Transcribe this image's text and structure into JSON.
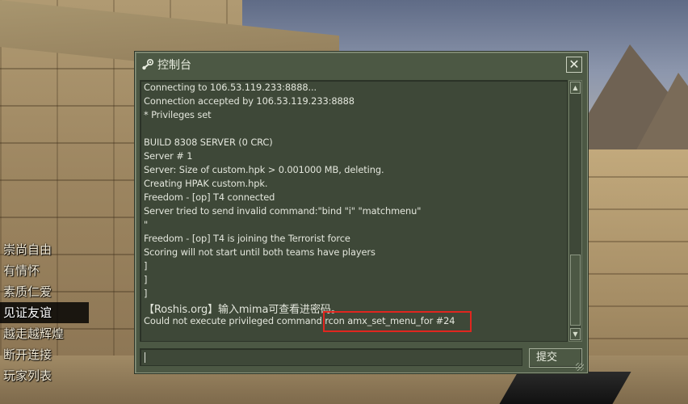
{
  "window": {
    "title": "控制台",
    "close_symbol": "✕",
    "submit_label": "提交",
    "input_value": ""
  },
  "console_lines": [
    "Connecting to 106.53.119.233:8888...",
    "Connection accepted by 106.53.119.233:8888",
    "* Privileges set",
    "",
    "BUILD 8308 SERVER (0 CRC)",
    "Server # 1",
    "Server: Size of custom.hpk > 0.001000 MB, deleting.",
    "Creating HPAK custom.hpk.",
    "Freedom - [op] T4 connected",
    "Server tried to send invalid command:\"bind \"i\" \"matchmenu\"",
    "\"",
    "Freedom - [op] T4 is joining the Terrorist force",
    "Scoring will not start until both teams have players",
    "]",
    "]",
    "]",
    "【Roshis.org】输入mima可查看进密码。",
    "Could not execute privileged command rcon amx_set_menu_for #24"
  ],
  "side_menu": [
    {
      "label": "崇尚自由",
      "active": false
    },
    {
      "label": "有情怀",
      "active": false
    },
    {
      "label": "素质仁爱",
      "active": false
    },
    {
      "label": "见证友谊",
      "active": true
    },
    {
      "label": "越走越辉煌",
      "active": false
    },
    {
      "label": "断开连接",
      "active": false
    },
    {
      "label": "玩家列表",
      "active": false
    }
  ],
  "icons": {
    "title": "steam-icon",
    "scroll_up": "arrow-up-icon",
    "scroll_down": "arrow-down-icon"
  },
  "colors": {
    "window_bg": "#4c5844",
    "output_bg": "#3e4838",
    "text": "#e3e6dc",
    "highlight": "#e0261f"
  }
}
